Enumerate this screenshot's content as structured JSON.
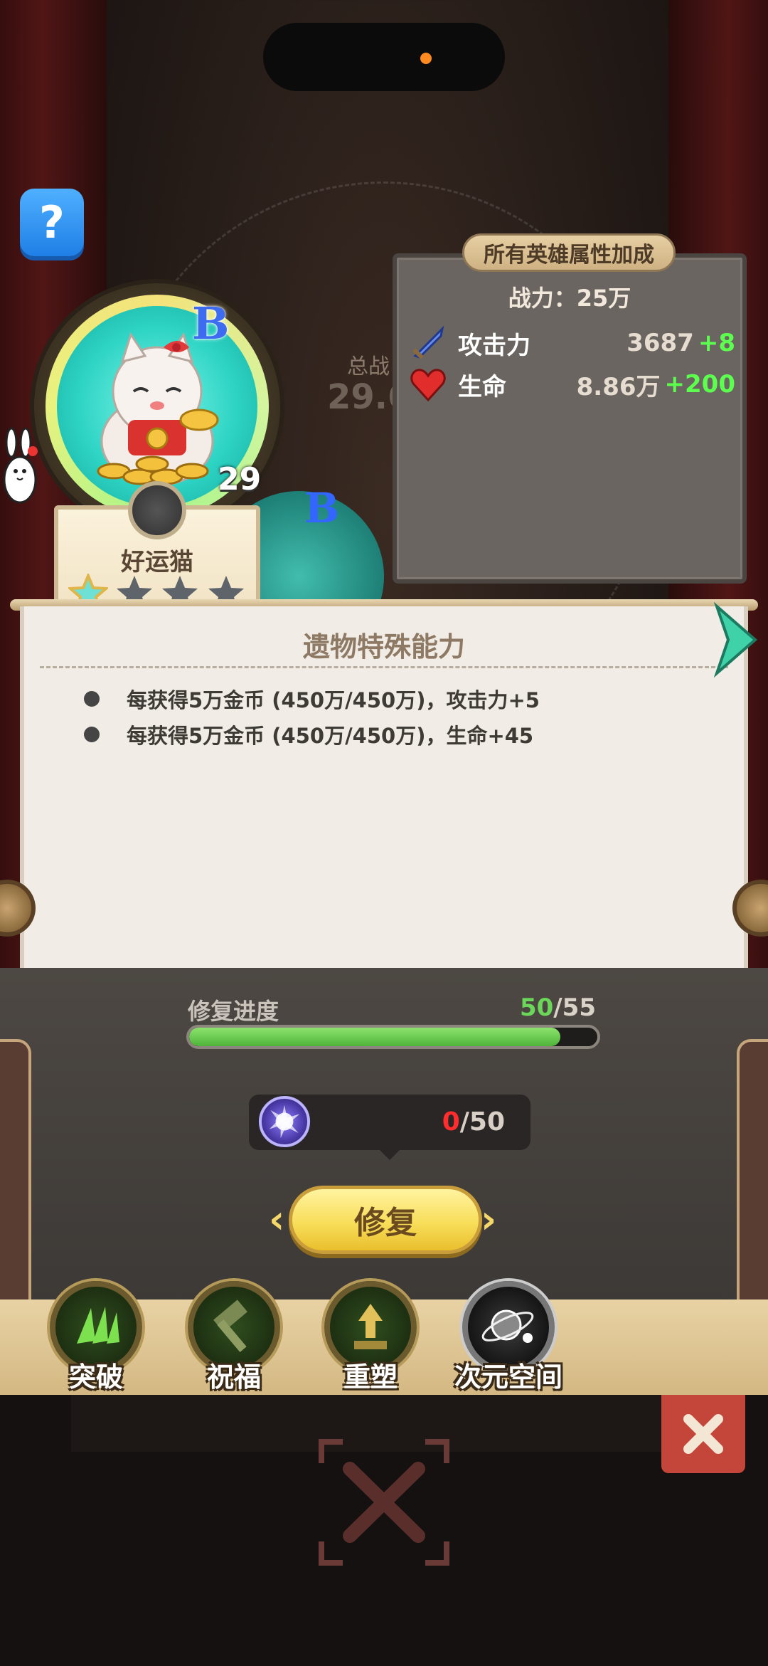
{
  "help": {
    "label": "?"
  },
  "hero": {
    "grade": "B",
    "level": "29",
    "name": "好运猫",
    "stars_filled": 1,
    "stars_total": 4
  },
  "background_hint": {
    "label": "总战",
    "value": "29.6"
  },
  "stats_panel": {
    "title": "所有英雄属性加成",
    "power": "战力：25万",
    "rows": [
      {
        "icon": "sword-icon",
        "name": "攻击力",
        "value": "3687",
        "bonus": "+8"
      },
      {
        "icon": "heart-icon",
        "name": "生命",
        "value": "8.86万",
        "bonus": "+200"
      }
    ]
  },
  "ability_panel": {
    "title": "遗物特殊能力",
    "abilities": [
      "每获得5万金币 (450万/450万)，攻击力+5",
      "每获得5万金币 (450万/450万)，生命+45"
    ]
  },
  "repair": {
    "progress_label": "修复进度",
    "progress_current": "50",
    "progress_total": "/55",
    "progress_fraction": 0.909,
    "cost_current": "0",
    "cost_total": "/50",
    "button_label": "修复",
    "chevron_left": "‹",
    "chevron_right": "›"
  },
  "nav": [
    {
      "label": "突破",
      "icon": "claw-icon"
    },
    {
      "label": "祝福",
      "icon": "hammer-icon"
    },
    {
      "label": "重塑",
      "icon": "anvil-icon"
    },
    {
      "label": "次元空间",
      "icon": "portal-icon"
    }
  ],
  "colors": {
    "accent_green": "#5dff4f",
    "progress_green": "#4fb43a",
    "cost_red": "#ff2d2d",
    "button_yellow": "#f8de5a"
  }
}
